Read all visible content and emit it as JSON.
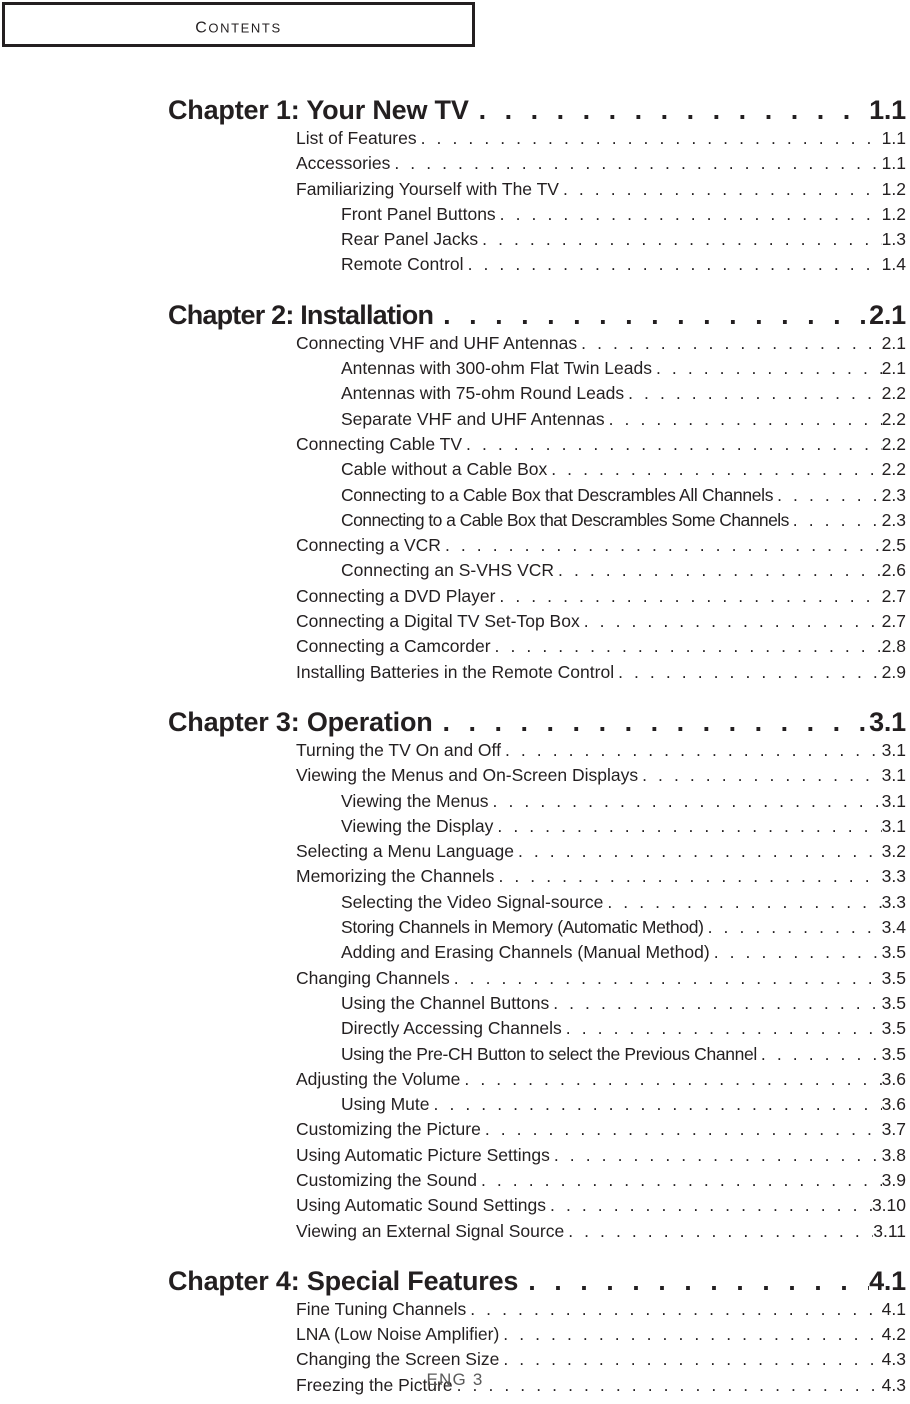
{
  "header": {
    "title": "CONTENTS",
    "title_lead": "C",
    "title_rest": "ONTENTS"
  },
  "footer": {
    "text": "ENG 3"
  },
  "leader_dot": ". . . . . . . . . . . . . . . . . . . . . . . . . . . . . . . . . . . . . . . . . . . . . . . . . . . . . . . . . . . . . . . . . . . . . . . . . . . .",
  "chapters": [
    {
      "title": "Chapter 1: Your New TV",
      "page": "1.1",
      "entries": [
        {
          "level": 1,
          "title": "List of Features",
          "page": "1.1"
        },
        {
          "level": 1,
          "title": "Accessories",
          "page": "1.1"
        },
        {
          "level": 1,
          "title": "Familiarizing Yourself with The TV",
          "page": "1.2"
        },
        {
          "level": 2,
          "title": "Front Panel Buttons",
          "page": "1.2"
        },
        {
          "level": 2,
          "title": "Rear Panel Jacks",
          "page": "1.3"
        },
        {
          "level": 2,
          "title": "Remote Control",
          "page": "1.4"
        }
      ]
    },
    {
      "title": "Chapter 2: Installation",
      "page": "2.1",
      "entries": [
        {
          "level": 1,
          "title": "Connecting VHF and UHF Antennas",
          "page": "2.1"
        },
        {
          "level": 2,
          "title": "Antennas with 300-ohm Flat Twin Leads",
          "page": "2.1"
        },
        {
          "level": 2,
          "title": "Antennas with 75-ohm Round Leads",
          "page": "2.2"
        },
        {
          "level": 2,
          "title": "Separate VHF and UHF Antennas",
          "page": "2.2"
        },
        {
          "level": 1,
          "title": "Connecting Cable TV",
          "page": "2.2"
        },
        {
          "level": 2,
          "title": "Cable without a Cable Box",
          "page": "2.2"
        },
        {
          "level": 2,
          "title": "Connecting to a Cable Box that Descrambles All Channels",
          "page": "2.3"
        },
        {
          "level": 2,
          "title": "Connecting to a Cable Box that Descrambles Some Channels",
          "page": "2.3"
        },
        {
          "level": 1,
          "title": "Connecting a VCR",
          "page": "2.5"
        },
        {
          "level": 2,
          "title": "Connecting an S-VHS VCR",
          "page": "2.6"
        },
        {
          "level": 1,
          "title": "Connecting a DVD Player",
          "page": "2.7"
        },
        {
          "level": 1,
          "title": "Connecting a Digital TV Set-Top Box",
          "page": "2.7"
        },
        {
          "level": 1,
          "title": "Connecting a Camcorder",
          "page": "2.8"
        },
        {
          "level": 1,
          "title": "Installing Batteries in the Remote Control",
          "page": "2.9"
        }
      ]
    },
    {
      "title": "Chapter 3: Operation",
      "page": "3.1",
      "entries": [
        {
          "level": 1,
          "title": "Turning the TV On and Off",
          "page": "3.1"
        },
        {
          "level": 1,
          "title": "Viewing the Menus and On-Screen Displays",
          "page": "3.1"
        },
        {
          "level": 2,
          "title": "Viewing the Menus",
          "page": "3.1"
        },
        {
          "level": 2,
          "title": "Viewing the Display",
          "page": "3.1"
        },
        {
          "level": 1,
          "title": "Selecting a Menu Language",
          "page": "3.2"
        },
        {
          "level": 1,
          "title": "Memorizing the Channels",
          "page": "3.3"
        },
        {
          "level": 2,
          "title": "Selecting the Video Signal-source",
          "page": "3.3"
        },
        {
          "level": 2,
          "title": "Storing Channels in Memory (Automatic Method)",
          "page": "3.4"
        },
        {
          "level": 2,
          "title": "Adding and Erasing Channels (Manual Method)",
          "page": "3.5"
        },
        {
          "level": 1,
          "title": "Changing Channels",
          "page": "3.5"
        },
        {
          "level": 2,
          "title": "Using the Channel Buttons",
          "page": "3.5"
        },
        {
          "level": 2,
          "title": "Directly Accessing Channels",
          "page": "3.5"
        },
        {
          "level": 2,
          "title": "Using the Pre-CH Button to select the Previous Channel",
          "page": "3.5"
        },
        {
          "level": 1,
          "title": "Adjusting the Volume",
          "page": "3.6"
        },
        {
          "level": 2,
          "title": "Using Mute",
          "page": "3.6"
        },
        {
          "level": 1,
          "title": "Customizing the Picture",
          "page": "3.7"
        },
        {
          "level": 1,
          "title": "Using Automatic Picture Settings",
          "page": "3.8"
        },
        {
          "level": 1,
          "title": "Customizing the Sound",
          "page": "3.9"
        },
        {
          "level": 1,
          "title": "Using Automatic Sound Settings",
          "page": "3.10"
        },
        {
          "level": 1,
          "title": "Viewing an External Signal Source",
          "page": "3.11"
        }
      ]
    },
    {
      "title": "Chapter 4: Special Features",
      "page": "4.1",
      "entries": [
        {
          "level": 1,
          "title": "Fine Tuning Channels",
          "page": "4.1"
        },
        {
          "level": 1,
          "title": "LNA (Low Noise Amplifier)",
          "page": "4.2"
        },
        {
          "level": 1,
          "title": "Changing the Screen Size",
          "page": "4.3"
        },
        {
          "level": 1,
          "title": "Freezing the Picture",
          "page": "4.3"
        }
      ]
    }
  ]
}
